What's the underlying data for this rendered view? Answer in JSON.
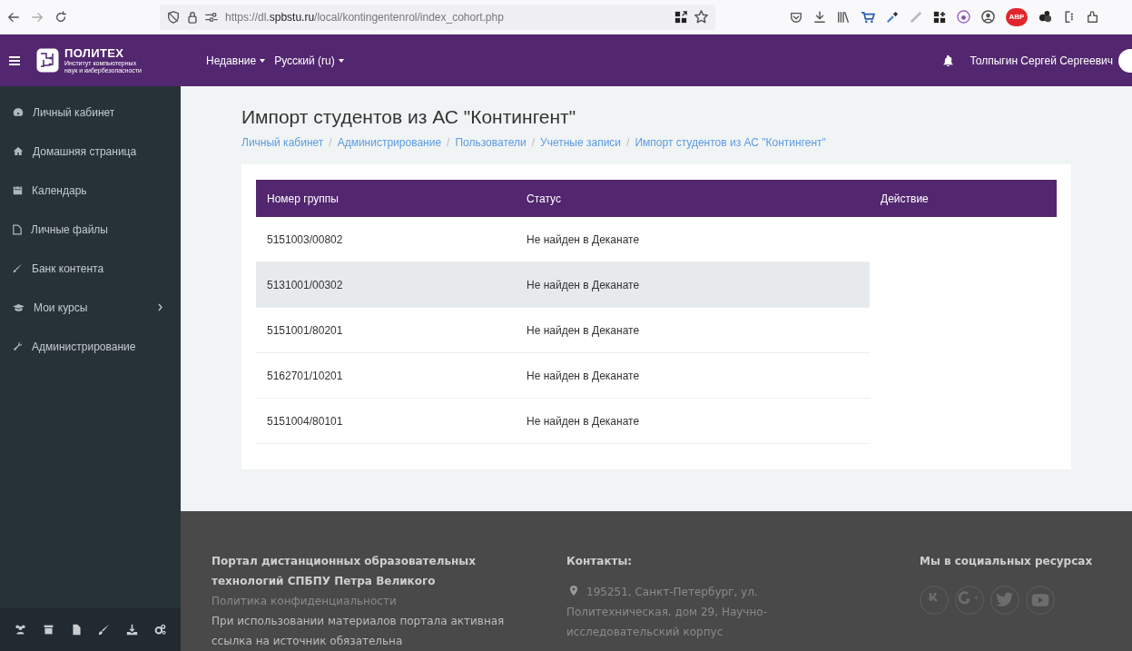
{
  "browser": {
    "url_prefix": "https://dl.",
    "url_domain": "spbstu.ru",
    "url_path": "/local/kontingentenrol/index_cohort.php",
    "extension_badge": "ABP"
  },
  "header": {
    "logo_title": "ПОЛИТЕХ",
    "logo_subtitle": [
      "Институт компьютерных",
      "наук и кибербезопасности"
    ],
    "menus": [
      "Недавние",
      "Русский (ru)"
    ],
    "user_name": "Толпыгин Сергей Сергеевич"
  },
  "sidebar": {
    "items": [
      {
        "label": "Личный кабинет",
        "has_submenu": false
      },
      {
        "label": "Домашняя страница",
        "has_submenu": false
      },
      {
        "label": "Календарь",
        "has_submenu": false
      },
      {
        "label": "Личные файлы",
        "has_submenu": false
      },
      {
        "label": "Банк контента",
        "has_submenu": false
      },
      {
        "label": "Мои курсы",
        "has_submenu": true
      },
      {
        "label": "Администрирование",
        "has_submenu": false
      }
    ]
  },
  "page": {
    "title": "Импорт студентов из АС \"Контингент\"",
    "breadcrumb_separator": "/",
    "breadcrumb": [
      "Личный кабинет",
      "Администрирование",
      "Пользователи",
      "Учетные записи",
      "Импорт студентов из АС \"Контингент\""
    ]
  },
  "table": {
    "columns": [
      "Номер группы",
      "Статус",
      "Действие"
    ],
    "rows": [
      {
        "group": "5151003/00802",
        "status": "Не найден в Деканате",
        "highlighted": false
      },
      {
        "group": "5131001/00302",
        "status": "Не найден в Деканате",
        "highlighted": true
      },
      {
        "group": "5151001/80201",
        "status": "Не найден в Деканате",
        "highlighted": false
      },
      {
        "group": "5162701/10201",
        "status": "Не найден в Деканате",
        "highlighted": false
      },
      {
        "group": "5151004/80101",
        "status": "Не найден в Деканате",
        "highlighted": false
      }
    ]
  },
  "footer": {
    "about_title": "Портал дистанционных образовательных технологий СПБПУ Петра Великого",
    "privacy_link": "Политика конфиденциальности",
    "notice": "При использовании материалов портала активная ссылка на источник обязательна",
    "contacts_title": "Контакты:",
    "address": "195251, Санкт-Петербург, ул. Политехническая, дом 29, Научно-исследовательский корпус",
    "social_title": "Мы в социальных ресурсах"
  }
}
